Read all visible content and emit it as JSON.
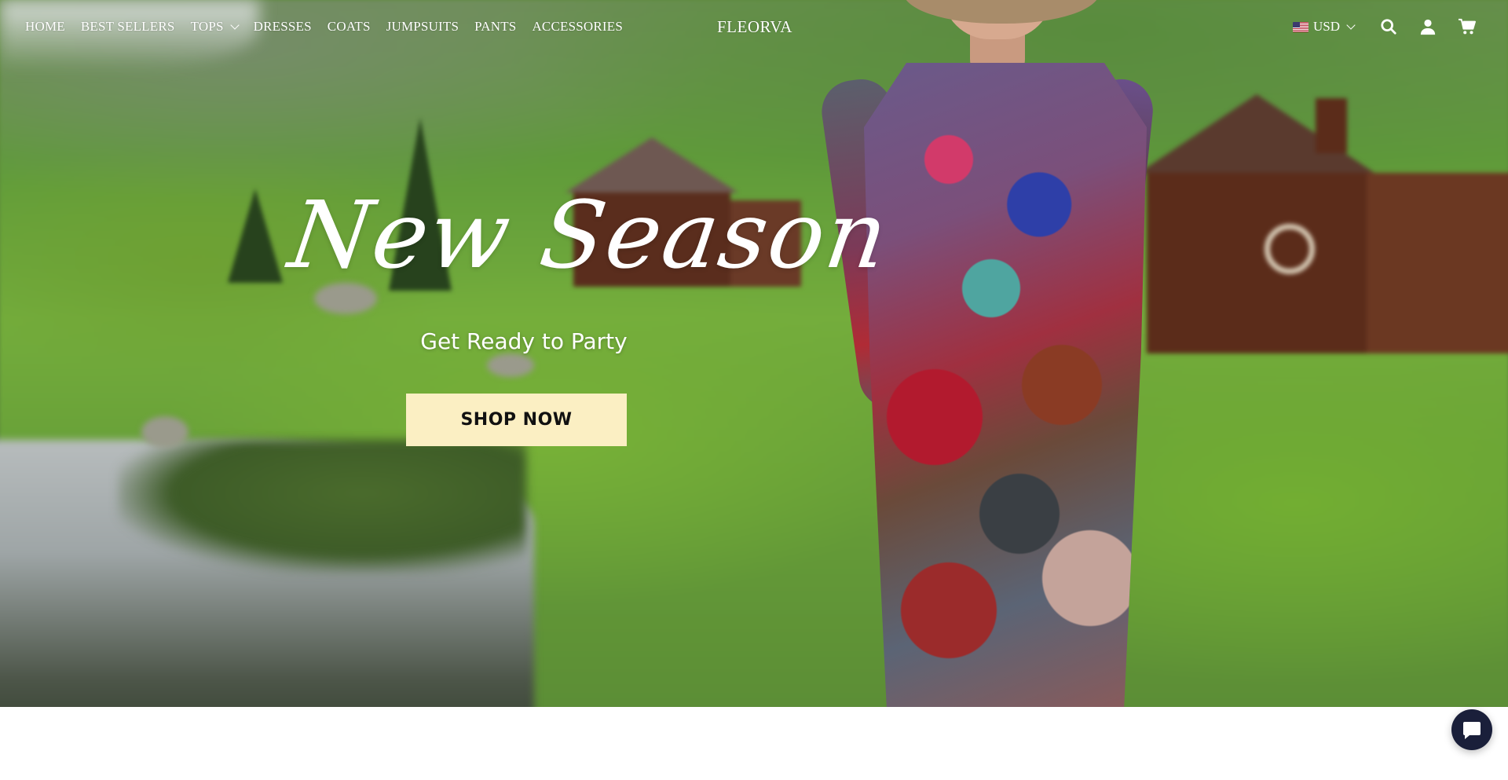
{
  "nav": {
    "items": [
      {
        "label": "HOME",
        "has_dropdown": false
      },
      {
        "label": "BEST SELLERS",
        "has_dropdown": false
      },
      {
        "label": "TOPS",
        "has_dropdown": true
      },
      {
        "label": "DRESSES",
        "has_dropdown": false
      },
      {
        "label": "COATS",
        "has_dropdown": false
      },
      {
        "label": "JUMPSUITS",
        "has_dropdown": false
      },
      {
        "label": "PANTS",
        "has_dropdown": false
      },
      {
        "label": "ACCESSORIES",
        "has_dropdown": false
      }
    ],
    "brand": "FLEORVA",
    "currency": {
      "label": "USD",
      "flag_icon": "us-flag-icon"
    },
    "icons": [
      "search-icon",
      "account-icon",
      "cart-icon"
    ]
  },
  "hero": {
    "script_title": "New Season",
    "subtitle": "Get Ready to Party",
    "cta_label": "SHOP NOW",
    "cta_bg": "#fbefc3"
  },
  "chat": {
    "icon": "chat-icon",
    "color": "#1a1f3a"
  }
}
